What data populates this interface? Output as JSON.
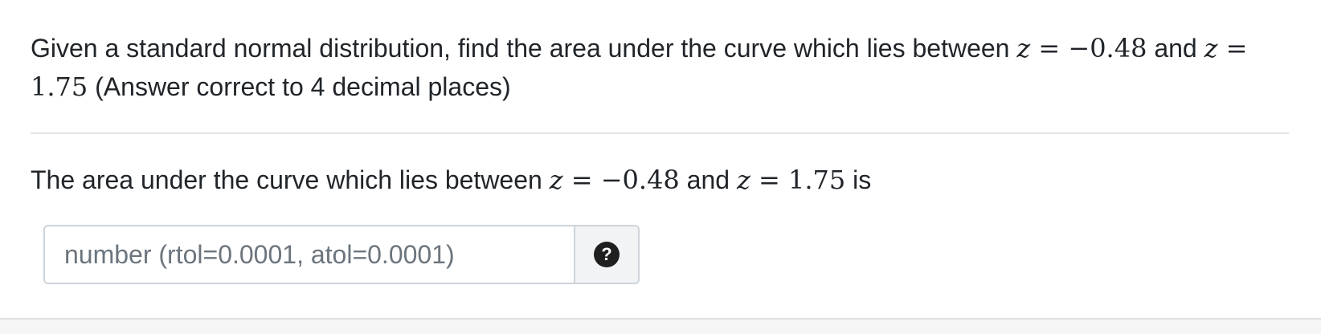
{
  "question": {
    "text_before": "Given a standard normal distribution, find the area under the curve which lies between ",
    "z1_var": "z",
    "z1_eq": " = ",
    "z1_value": "−0.48",
    "and_text": " and ",
    "z2_var": "z",
    "z2_eq": " = ",
    "z2_value": "1.75",
    "text_after": " (Answer correct to 4 decimal places)"
  },
  "answer": {
    "text_before": "The area under the curve which lies between ",
    "z1_var": "z",
    "z1_eq": " = ",
    "z1_value": "−0.48",
    "and_text": " and ",
    "z2_var": "z",
    "z2_eq": " = ",
    "z2_value": "1.75",
    "text_after": " is"
  },
  "input": {
    "value": "",
    "placeholder": "number (rtol=0.0001, atol=0.0001)"
  },
  "help": {
    "icon": "question-circle-icon",
    "glyph": "?"
  }
}
